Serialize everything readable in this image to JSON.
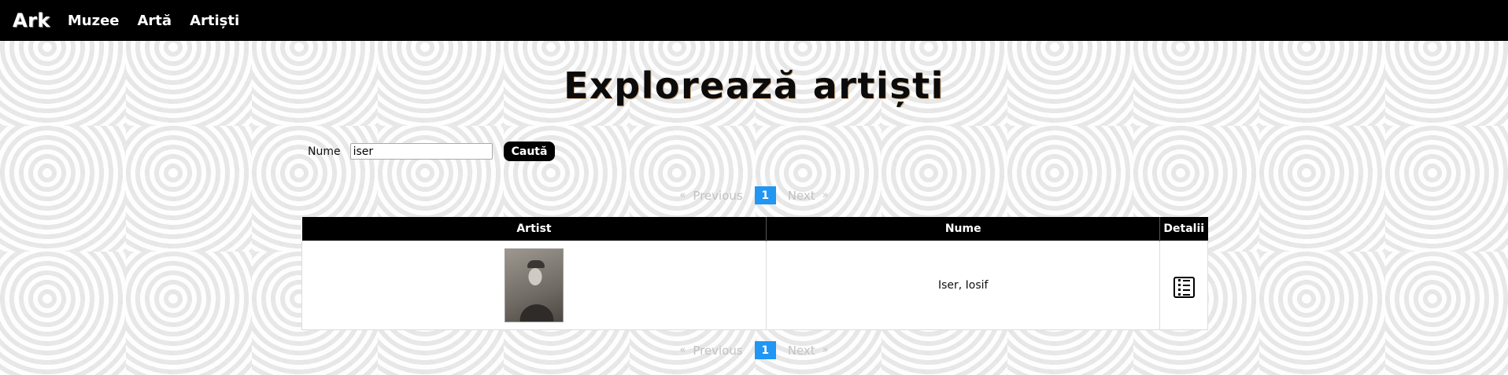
{
  "navbar": {
    "brand": "Ark",
    "links": [
      "Muzee",
      "Artă",
      "Artiști"
    ]
  },
  "page": {
    "title": "Explorează artiști"
  },
  "search": {
    "label": "Nume",
    "value": "iser",
    "button": "Caută"
  },
  "pagination": {
    "prev_arrow": "«",
    "prev": "Previous",
    "current_page": "1",
    "next": "Next",
    "next_arrow": "»"
  },
  "table": {
    "headers": [
      "Artist",
      "Nume",
      "Detalii"
    ],
    "rows": [
      {
        "name": "Iser, Iosif",
        "details_icon": "list-details-icon"
      }
    ]
  },
  "colors": {
    "navbar": "#000000",
    "page_active": "#2196f3",
    "page_disabled": "#c2c2c2"
  }
}
